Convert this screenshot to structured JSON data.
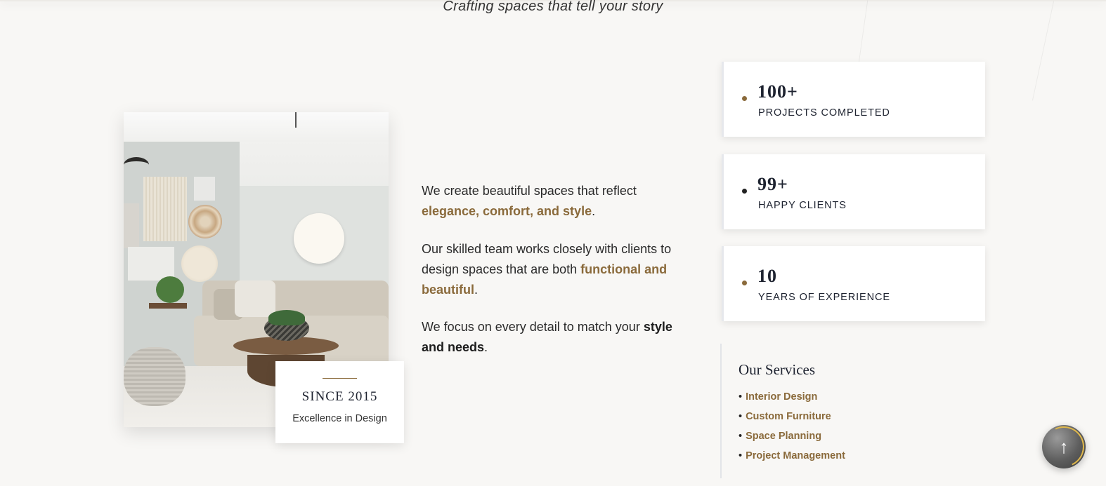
{
  "hero": {
    "tagline": "Crafting spaces that tell your story"
  },
  "since_card": {
    "title": "SINCE 2015",
    "subtitle": "Excellence in Design"
  },
  "about": {
    "p1": {
      "text": "We create beautiful spaces that reflect ",
      "accent": "elegance, comfort, and style",
      "end": "."
    },
    "p2": {
      "text": "Our skilled team works closely with clients to design spaces that are both ",
      "accent": "functional and beautiful",
      "end": "."
    },
    "p3": {
      "text": "We focus on every detail to match your ",
      "strong": "style and needs",
      "end": "."
    }
  },
  "stats": [
    {
      "value": "100+",
      "label": "PROJECTS COMPLETED",
      "dot_color": "#8a6a3b"
    },
    {
      "value": "99+",
      "label": "HAPPY CLIENTS",
      "dot_color": "#222222"
    },
    {
      "value": "10",
      "label": "YEARS OF EXPERIENCE",
      "dot_color": "#8a6a3b"
    }
  ],
  "services": {
    "title": "Our Services",
    "items": [
      "Interior Design",
      "Custom Furniture",
      "Space Planning",
      "Project Management"
    ]
  },
  "scroll_top": {
    "icon": "arrow-up-icon",
    "glyph": "↑"
  },
  "colors": {
    "accent": "#8a6a3b",
    "background": "#f8f7f5",
    "heading": "#1e2330"
  }
}
